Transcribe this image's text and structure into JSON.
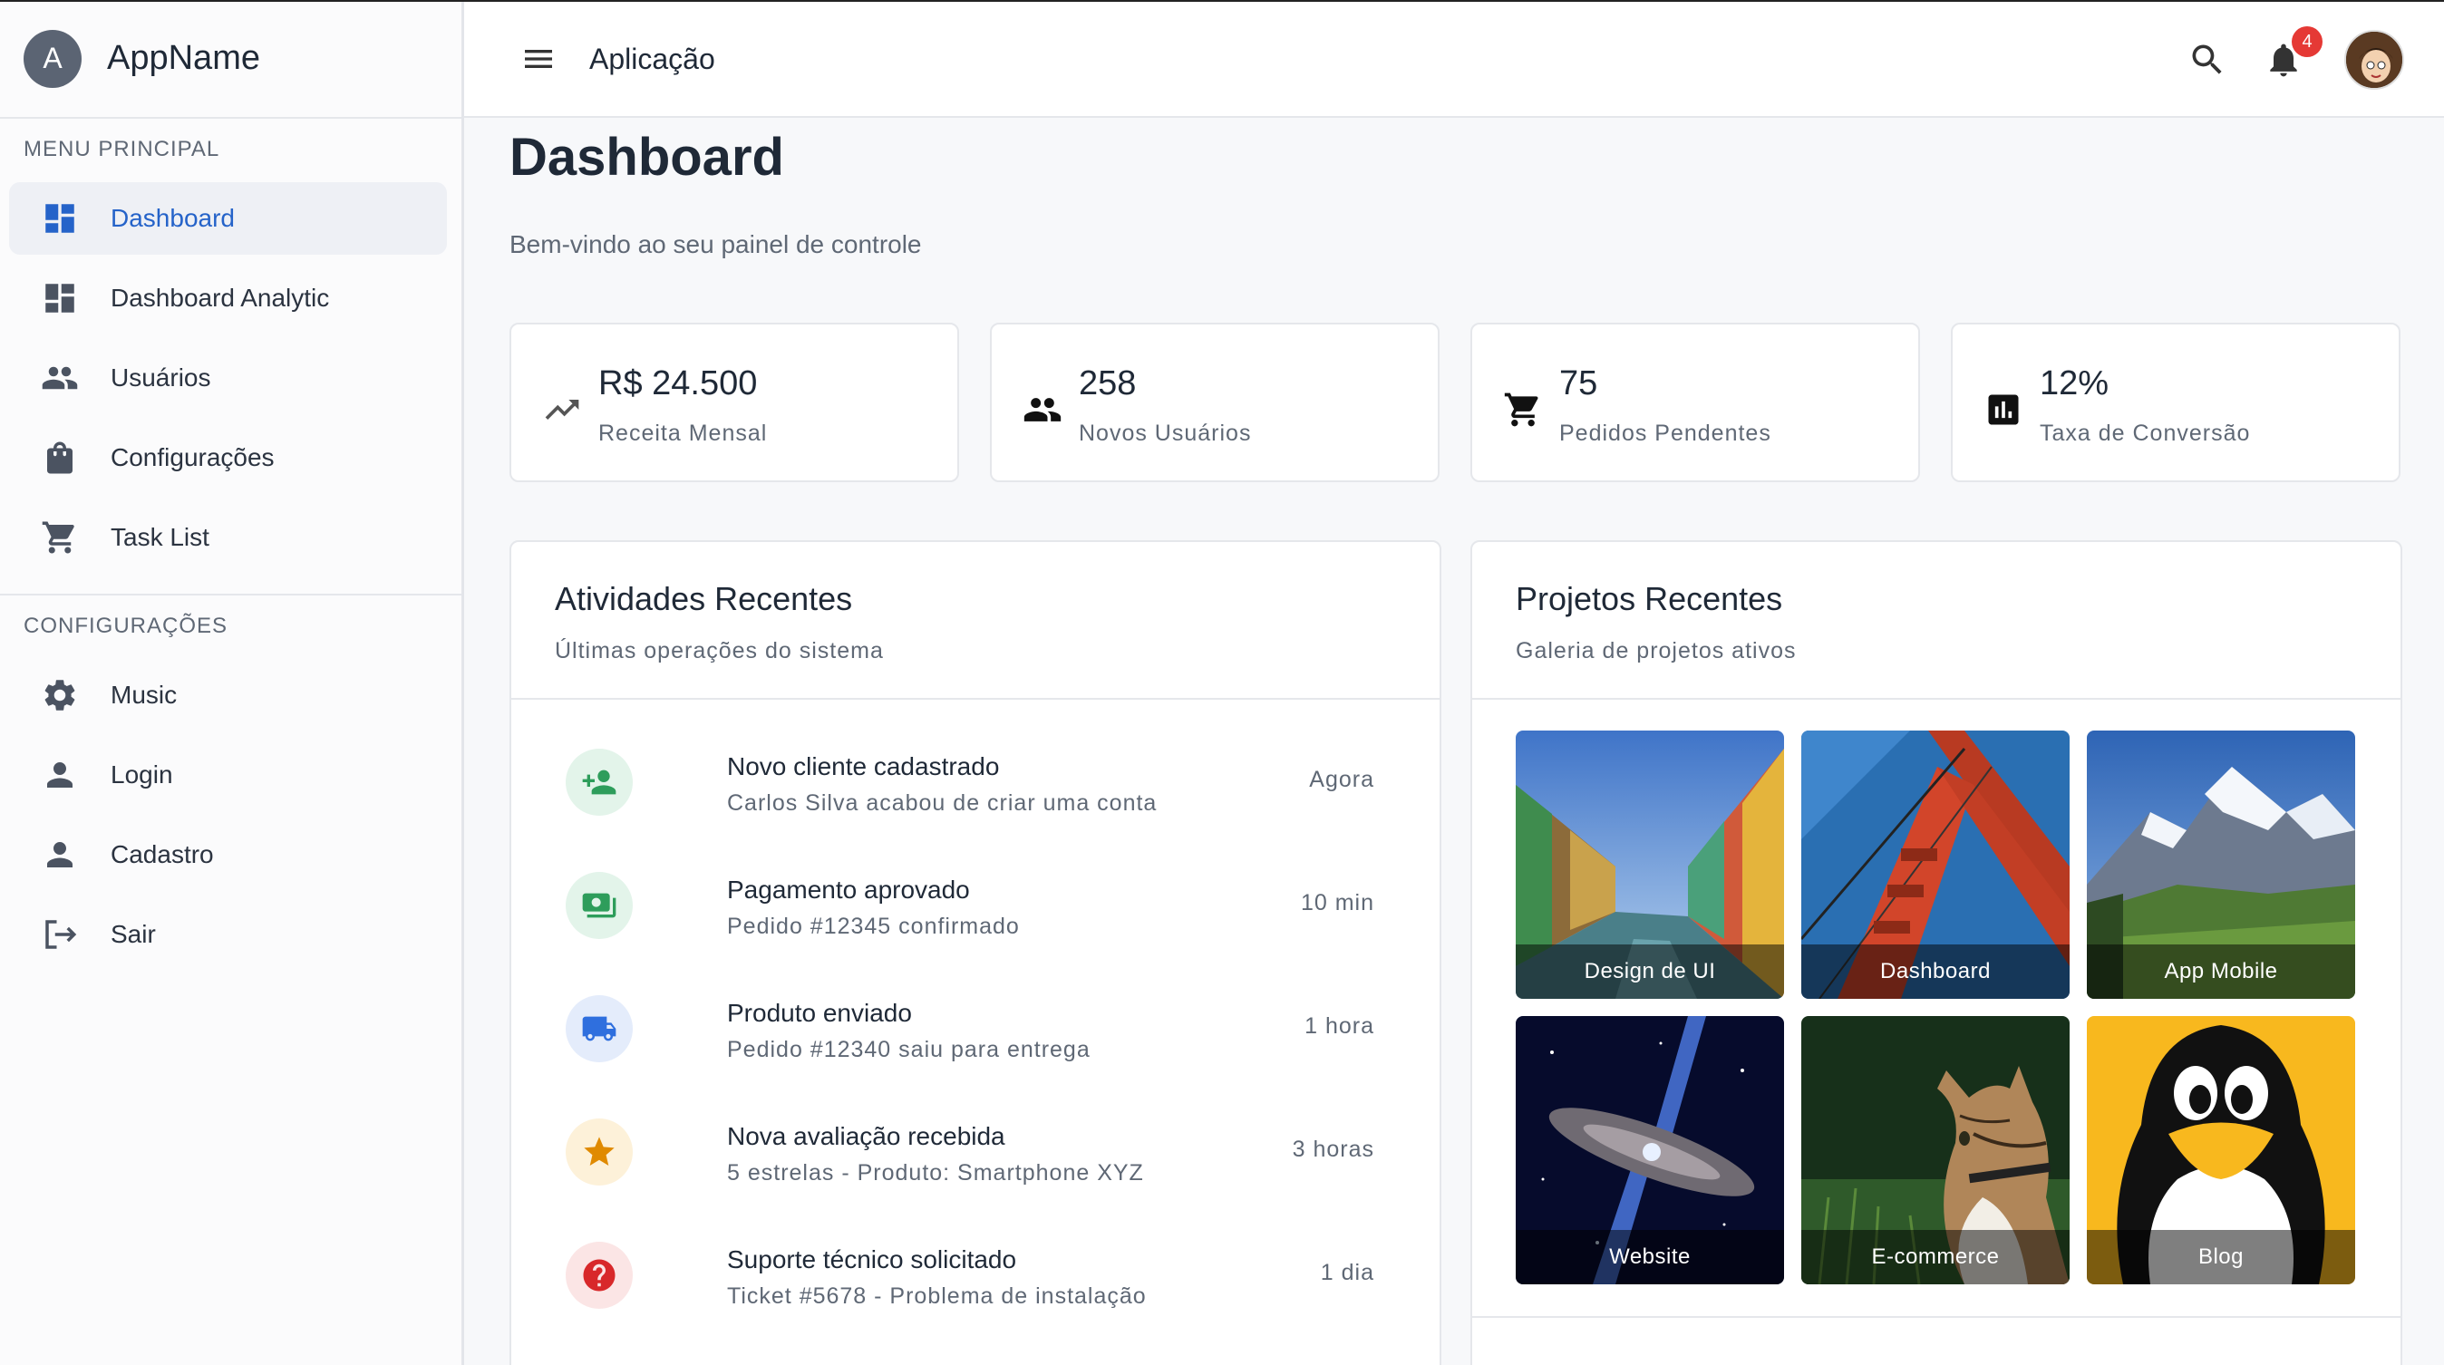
{
  "app": {
    "avatar_letter": "A",
    "name": "AppName"
  },
  "header": {
    "title": "Aplicação",
    "notification_count": "4"
  },
  "sidebar": {
    "section_main": "MENU PRINCIPAL",
    "items_main": [
      {
        "label": "Dashboard",
        "icon": "dashboard-icon",
        "active": true
      },
      {
        "label": "Dashboard Analytic",
        "icon": "dashboard-icon"
      },
      {
        "label": "Usuários",
        "icon": "people-icon"
      },
      {
        "label": "Configurações",
        "icon": "shopping-bag-icon"
      },
      {
        "label": "Task List",
        "icon": "cart-icon"
      }
    ],
    "section_config": "CONFIGURAÇÕES",
    "items_config": [
      {
        "label": "Music",
        "icon": "gear-icon"
      },
      {
        "label": "Login",
        "icon": "person-icon"
      },
      {
        "label": "Cadastro",
        "icon": "person-icon"
      },
      {
        "label": "Sair",
        "icon": "logout-icon"
      }
    ]
  },
  "page": {
    "title": "Dashboard",
    "subtitle": "Bem-vindo ao seu painel de controle"
  },
  "stats": [
    {
      "value": "R$ 24.500",
      "label": "Receita Mensal",
      "icon": "trending-up-icon"
    },
    {
      "value": "258",
      "label": "Novos Usuários",
      "icon": "people-icon"
    },
    {
      "value": "75",
      "label": "Pedidos Pendentes",
      "icon": "cart-icon"
    },
    {
      "value": "12%",
      "label": "Taxa de Conversão",
      "icon": "bar-chart-icon"
    }
  ],
  "activities": {
    "title": "Atividades Recentes",
    "subtitle": "Últimas operações do sistema",
    "items": [
      {
        "title": "Novo cliente cadastrado",
        "desc": "Carlos Silva acabou de criar uma conta",
        "time": "Agora",
        "icon": "person-add-icon",
        "color": "#2e9d5b",
        "bg": "#e3f4ea"
      },
      {
        "title": "Pagamento aprovado",
        "desc": "Pedido #12345 confirmado",
        "time": "10 min",
        "icon": "payment-icon",
        "color": "#2e9d5b",
        "bg": "#e3f4ea"
      },
      {
        "title": "Produto enviado",
        "desc": "Pedido #12340 saiu para entrega",
        "time": "1 hora",
        "icon": "truck-icon",
        "color": "#2f6fde",
        "bg": "#e4ecfb"
      },
      {
        "title": "Nova avaliação recebida",
        "desc": "5 estrelas - Produto: Smartphone XYZ",
        "time": "3 horas",
        "icon": "star-icon",
        "color": "#e08a00",
        "bg": "#fdf1d9"
      },
      {
        "title": "Suporte técnico solicitado",
        "desc": "Ticket #5678 - Problema de instalação",
        "time": "1 dia",
        "icon": "help-icon",
        "color": "#d8282a",
        "bg": "#fbe5e5"
      }
    ]
  },
  "projects": {
    "title": "Projetos Recentes",
    "subtitle": "Galeria de projetos ativos",
    "items": [
      {
        "label": "Design de UI"
      },
      {
        "label": "Dashboard"
      },
      {
        "label": "App Mobile"
      },
      {
        "label": "Website"
      },
      {
        "label": "E-commerce"
      },
      {
        "label": "Blog"
      }
    ]
  }
}
